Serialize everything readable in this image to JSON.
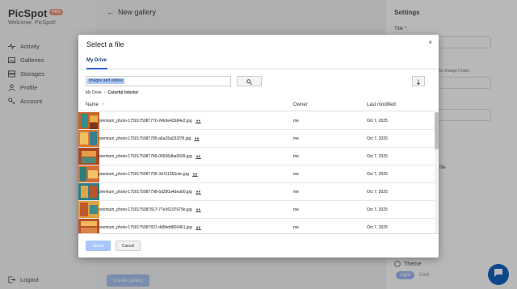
{
  "app": {
    "brand": "PicSpot",
    "badge": "PRO",
    "welcome": "Welcome, PicSpot!"
  },
  "sidebar": {
    "items": [
      {
        "label": "Activity",
        "icon": "activity-icon"
      },
      {
        "label": "Galleries",
        "icon": "image-icon"
      },
      {
        "label": "Storages",
        "icon": "storage-icon"
      },
      {
        "label": "Profile",
        "icon": "person-icon"
      },
      {
        "label": "Account",
        "icon": "key-icon"
      }
    ],
    "logout": "Logout"
  },
  "main": {
    "back_icon": "arrow-left-icon",
    "title": "New gallery",
    "create_button": "Create gallery"
  },
  "settings": {
    "title": "Settings",
    "title_label": "Title *",
    "hint": "to change it later.",
    "profile_text": "file",
    "theme_label": "Theme",
    "theme_light": "Light",
    "theme_dark": "Dark"
  },
  "dialog": {
    "title": "Select a file",
    "close": "×",
    "tab": "My Drive",
    "search_value": "Images and videos",
    "breadcrumb": [
      "My Drive",
      "Colorful Interior"
    ],
    "columns": {
      "name": "Name",
      "owner": "Owner",
      "modified": "Last modified"
    },
    "sort_indicator": "↑",
    "files": [
      {
        "name": "premium_photo-1750175087770-24b9e42b84e2.jpg",
        "owner": "me",
        "modified": "Oct 7, 2025"
      },
      {
        "name": "premium_photo-1750175087785-a6a25a032f78.jpg",
        "owner": "me",
        "modified": "Oct 7, 2025"
      },
      {
        "name": "premium_photo-1750175087789-00506dba0699.jpg",
        "owner": "me",
        "modified": "Oct 7, 2025"
      },
      {
        "name": "premium_photo-1750175087796-3d f11355cbc.jpg",
        "owner": "me",
        "modified": "Oct 7, 2025"
      },
      {
        "name": "premium_photo-1750175087798-6d280a4dea60.jpg",
        "owner": "me",
        "modified": "Oct 7, 2025"
      },
      {
        "name": "premium_photo-1750175087817-77e56197679e.jpg",
        "owner": "me",
        "modified": "Oct 7, 2025"
      },
      {
        "name": "premium_photo-1750175087837-dd9bdd800461.jpg",
        "owner": "me",
        "modified": "Oct 7, 2025"
      }
    ],
    "select_button": "Select",
    "cancel_button": "Cancel"
  },
  "colors": {
    "accent": "#2d5fcf",
    "selection": "#a8c7fa",
    "fab": "#1565c0"
  }
}
